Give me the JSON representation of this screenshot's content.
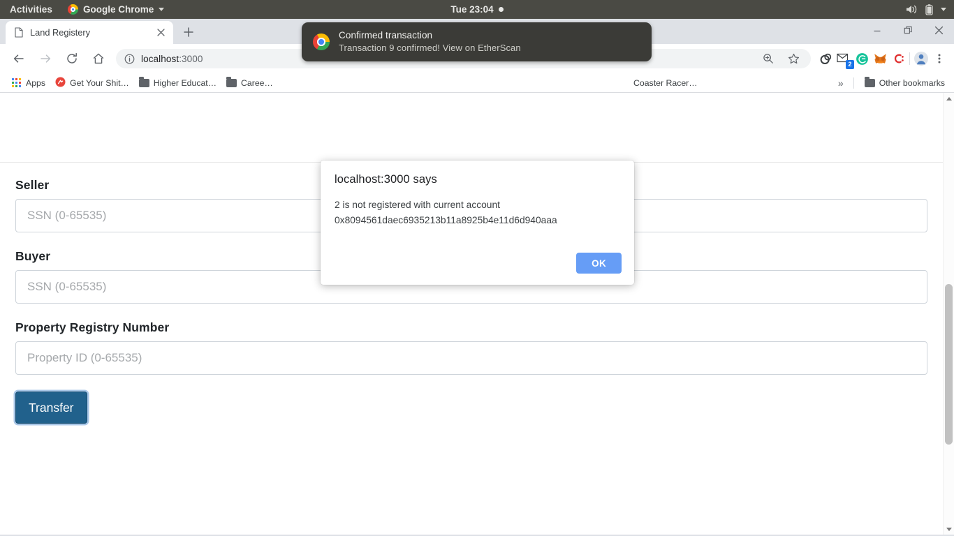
{
  "desktop": {
    "activities": "Activities",
    "app_menu": "Google Chrome",
    "clock": "Tue 23:04",
    "icons": {
      "chrome": "chrome-logo-icon",
      "recording_dot": "recording-dot-icon",
      "volume": "volume-icon",
      "battery": "battery-icon",
      "caret": "chevron-down-icon"
    }
  },
  "notification": {
    "app_icon": "chrome-logo-icon",
    "title": "Confirmed transaction",
    "body": "Transaction 9 confirmed! View on EtherScan"
  },
  "browser": {
    "tab": {
      "title": "Land Registery",
      "favicon": "page-icon",
      "close_icon": "close-icon"
    },
    "new_tab_icon": "plus-icon",
    "window_controls": {
      "minimize": "minimize-icon",
      "restore": "restore-icon",
      "close": "close-icon"
    },
    "toolbar": {
      "back_icon": "arrow-left-icon",
      "forward_icon": "arrow-right-icon",
      "reload_icon": "reload-icon",
      "home_icon": "home-icon",
      "info_icon": "info-circle-icon",
      "url_host": "localhost",
      "url_port": ":3000",
      "zoom_icon": "zoom-in-icon",
      "bookmark_icon": "star-icon",
      "extensions": [
        {
          "name": "extension-dark-circle-icon",
          "badge": ""
        },
        {
          "name": "extension-mail-icon",
          "badge": "2"
        },
        {
          "name": "extension-grammarly-icon",
          "badge": ""
        },
        {
          "name": "extension-metamask-fox-icon",
          "badge": ""
        },
        {
          "name": "extension-colon-c-icon",
          "badge": ""
        }
      ],
      "profile_icon": "avatar-icon",
      "menu_icon": "three-dot-menu-icon"
    },
    "bookmarks": {
      "items": [
        {
          "label": "Apps",
          "icon": "apps-grid-icon"
        },
        {
          "label": "Get Your Shit…",
          "icon": "red-circle-icon"
        },
        {
          "label": "Higher Educat…",
          "icon": "folder-icon"
        },
        {
          "label": "Caree…",
          "icon": "folder-icon"
        },
        {
          "label": "Coaster Racer…",
          "icon": "folder-icon"
        }
      ],
      "overflow_label": "»",
      "other_label": "Other bookmarks",
      "other_icon": "folder-icon"
    }
  },
  "page": {
    "form": {
      "seller_label": "Seller",
      "seller_placeholder": "SSN (0-65535)",
      "seller_value": "",
      "buyer_label": "Buyer",
      "buyer_placeholder": "SSN (0-65535)",
      "buyer_value": "",
      "property_label": "Property Registry Number",
      "property_placeholder": "Property ID (0-65535)",
      "property_value": "",
      "submit_label": "Transfer"
    },
    "scrollbar": {
      "up_icon": "triangle-up-icon",
      "down_icon": "triangle-down-icon"
    }
  },
  "dialog": {
    "title": "localhost:3000 says",
    "message_line1": "2 is not registered with current account",
    "message_line2": "0x8094561daec6935213b11a8925b4e11d6d940aaa",
    "ok_label": "OK"
  },
  "colors": {
    "accent_blue": "#669df6",
    "transfer_blue": "#21618c",
    "gnome_bar": "#4a4a44",
    "notification_bg": "#3b3b37",
    "chrome_frame": "#dee1e6"
  }
}
